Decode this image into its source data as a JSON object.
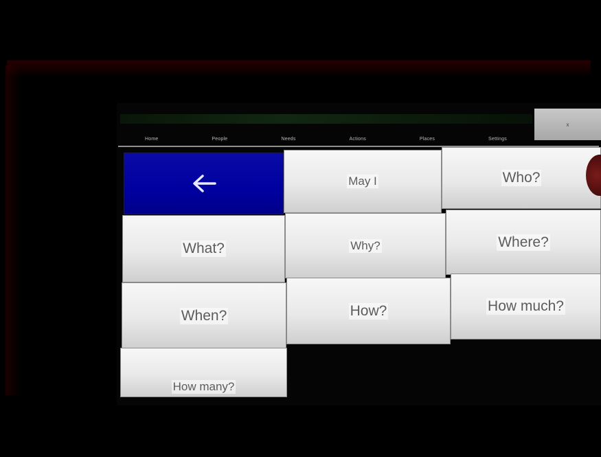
{
  "nav": {
    "tabs": [
      "Home",
      "People",
      "Needs",
      "Actions",
      "Places",
      "Settings"
    ],
    "corner_tab": "x"
  },
  "grid": {
    "back_button": {
      "icon": "left-arrow-icon",
      "color": "#0000a0"
    },
    "items": [
      {
        "label": "May I"
      },
      {
        "label": "Who?"
      },
      {
        "label": "What?"
      },
      {
        "label": "Why?"
      },
      {
        "label": "Where?"
      },
      {
        "label": "When?"
      },
      {
        "label": "How?"
      },
      {
        "label": "How much?"
      },
      {
        "label": "How many?"
      }
    ]
  }
}
